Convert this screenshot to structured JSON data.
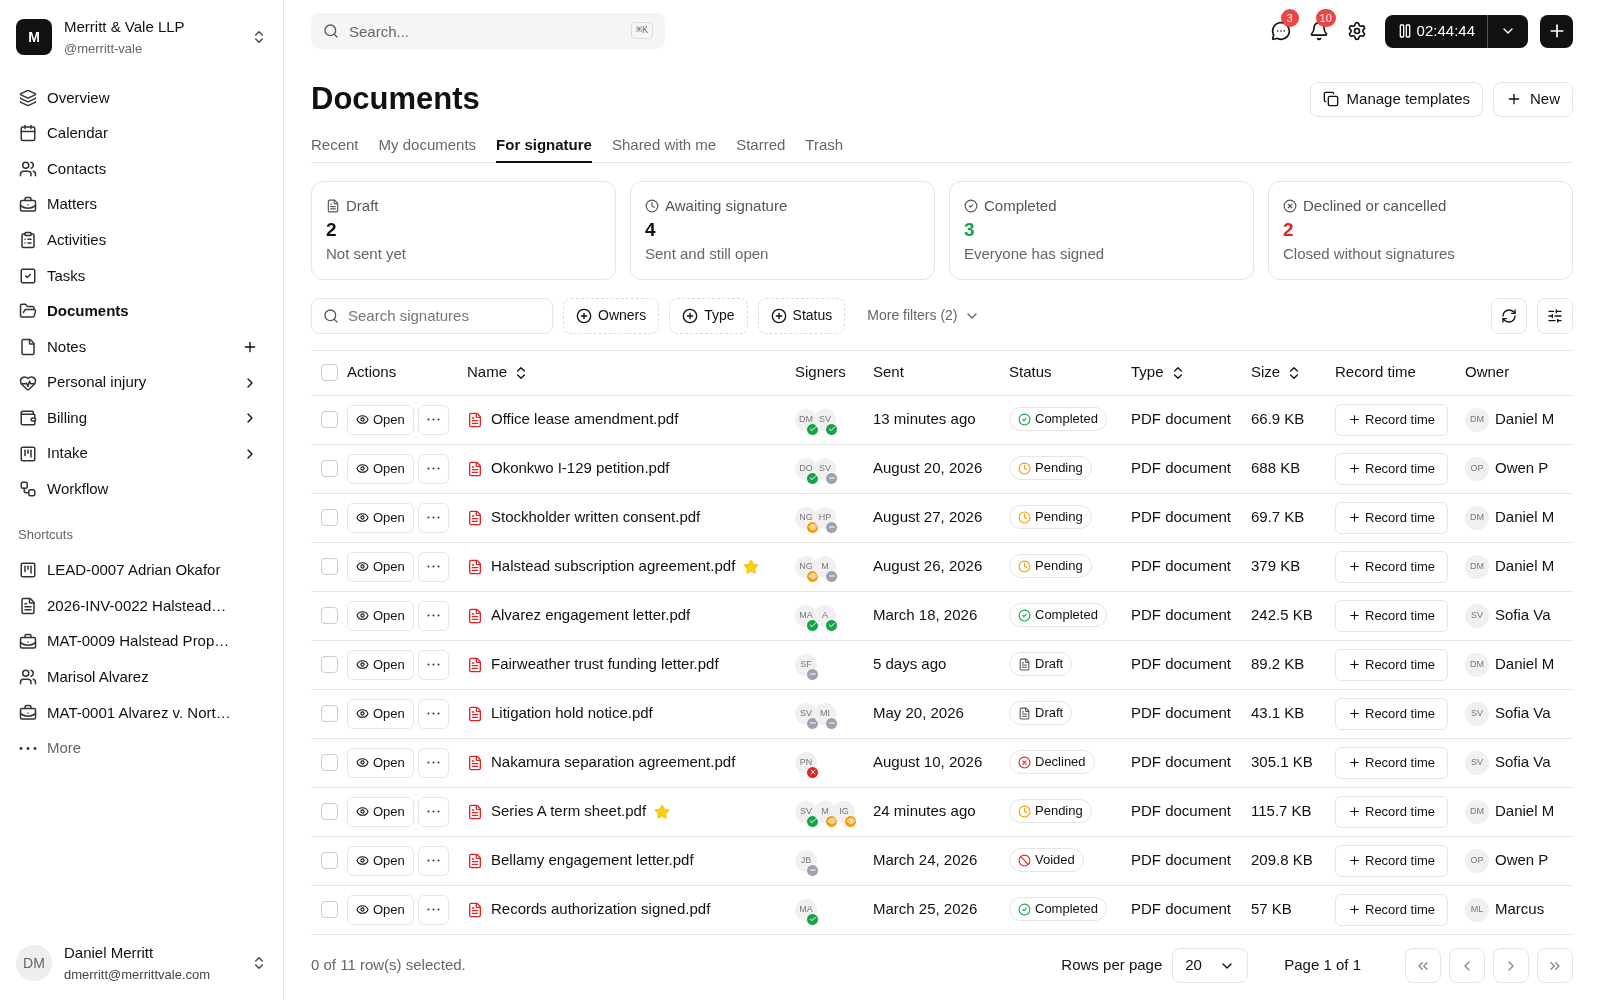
{
  "workspace": {
    "avatar": "M",
    "name": "Merritt & Vale LLP",
    "handle": "@merritt-vale"
  },
  "sidebar": {
    "items": [
      {
        "label": "Overview",
        "kind": "plain",
        "selected": false
      },
      {
        "label": "Calendar",
        "kind": "plain",
        "selected": false
      },
      {
        "label": "Contacts",
        "kind": "plain",
        "selected": false
      },
      {
        "label": "Matters",
        "kind": "plain",
        "selected": false
      },
      {
        "label": "Activities",
        "kind": "plain",
        "selected": false
      },
      {
        "label": "Tasks",
        "kind": "plain",
        "selected": false
      },
      {
        "label": "Documents",
        "kind": "plain",
        "selected": true
      },
      {
        "label": "Notes",
        "kind": "addable",
        "selected": false
      },
      {
        "label": "Personal injury",
        "kind": "expandable",
        "selected": false
      },
      {
        "label": "Billing",
        "kind": "expandable",
        "selected": false
      },
      {
        "label": "Intake",
        "kind": "expandable",
        "selected": false
      },
      {
        "label": "Workflow",
        "kind": "plain",
        "selected": false
      }
    ],
    "shortcuts_heading": "Shortcuts",
    "shortcuts": [
      {
        "label": "LEAD-0007 Adrian Okafor",
        "kind": "lead"
      },
      {
        "label": "2026-INV-0022 Halstead…",
        "kind": "invoice"
      },
      {
        "label": "MAT-0009 Halstead Prop…",
        "kind": "matter"
      },
      {
        "label": "Marisol Alvarez",
        "kind": "contact"
      },
      {
        "label": "MAT-0001 Alvarez v. Nort…",
        "kind": "matter"
      },
      {
        "label": "More",
        "kind": "more"
      }
    ]
  },
  "user": {
    "avatar": "DM",
    "name": "Daniel Merritt",
    "email": "dmerritt@merrittvale.com"
  },
  "topbar": {
    "search_placeholder": "Search...",
    "shortcut": "⌘K",
    "messages_badge": "3",
    "notifications_badge": "10",
    "timer": "02:44:44"
  },
  "page": {
    "title": "Documents",
    "buttons": [
      "Manage templates",
      "New"
    ]
  },
  "tabs": [
    {
      "label": "Recent",
      "selected": false
    },
    {
      "label": "My documents",
      "selected": false
    },
    {
      "label": "For signature",
      "selected": true
    },
    {
      "label": "Shared with me",
      "selected": false
    },
    {
      "label": "Starred",
      "selected": false
    },
    {
      "label": "Trash",
      "selected": false
    }
  ],
  "stats": [
    {
      "kind": "draft",
      "label": "Draft",
      "value": "2",
      "caption": "Not sent yet",
      "color": "#111111"
    },
    {
      "kind": "awaiting",
      "label": "Awaiting signature",
      "value": "4",
      "caption": "Sent and still open",
      "color": "#111111"
    },
    {
      "kind": "completed",
      "label": "Completed",
      "value": "3",
      "caption": "Everyone has signed",
      "color": "#16a34a"
    },
    {
      "kind": "declined",
      "label": "Declined or cancelled",
      "value": "2",
      "caption": "Closed without signatures",
      "color": "#dc2626"
    }
  ],
  "filters": {
    "search_placeholder": "Search signatures",
    "chips": [
      "Owners",
      "Type",
      "Status"
    ],
    "more": "More filters (2)"
  },
  "table": {
    "all_checked": false,
    "columns": [
      "Actions",
      "Name",
      "Signers",
      "Sent",
      "Status",
      "Type",
      "Size",
      "Record time",
      "Owner"
    ],
    "rows": [
      {
        "checked": false,
        "open": "Open",
        "name": "Office lease amendment.pdf",
        "starred": false,
        "signers": [
          {
            "initials": "DM",
            "kind": "signed"
          },
          {
            "initials": "SV",
            "kind": "signed"
          }
        ],
        "sent": "13 minutes ago",
        "status": {
          "label": "Completed",
          "kind": "completed"
        },
        "type": "PDF document",
        "size": "66.9 KB",
        "record": "Record time",
        "owner_initials": "DM",
        "owner": "Daniel M"
      },
      {
        "checked": false,
        "open": "Open",
        "name": "Okonkwo I-129 petition.pdf",
        "starred": false,
        "signers": [
          {
            "initials": "DO",
            "kind": "signed"
          },
          {
            "initials": "SV",
            "kind": "pending"
          }
        ],
        "sent": "August 20, 2026",
        "status": {
          "label": "Pending",
          "kind": "pending"
        },
        "type": "PDF document",
        "size": "688 KB",
        "record": "Record time",
        "owner_initials": "OP",
        "owner": "Owen P"
      },
      {
        "checked": false,
        "open": "Open",
        "name": "Stockholder written consent.pdf",
        "starred": false,
        "signers": [
          {
            "initials": "NG",
            "kind": "viewed"
          },
          {
            "initials": "HP",
            "kind": "pending"
          }
        ],
        "sent": "August 27, 2026",
        "status": {
          "label": "Pending",
          "kind": "pending"
        },
        "type": "PDF document",
        "size": "69.7 KB",
        "record": "Record time",
        "owner_initials": "DM",
        "owner": "Daniel M"
      },
      {
        "checked": false,
        "open": "Open",
        "name": "Halstead subscription agreement.pdf",
        "starred": true,
        "signers": [
          {
            "initials": "NG",
            "kind": "viewed"
          },
          {
            "initials": "M",
            "kind": "pending"
          }
        ],
        "sent": "August 26, 2026",
        "status": {
          "label": "Pending",
          "kind": "pending"
        },
        "type": "PDF document",
        "size": "379 KB",
        "record": "Record time",
        "owner_initials": "DM",
        "owner": "Daniel M"
      },
      {
        "checked": false,
        "open": "Open",
        "name": "Alvarez engagement letter.pdf",
        "starred": false,
        "signers": [
          {
            "initials": "MA",
            "kind": "signed"
          },
          {
            "initials": "A",
            "kind": "signed"
          }
        ],
        "sent": "March 18, 2026",
        "status": {
          "label": "Completed",
          "kind": "completed"
        },
        "type": "PDF document",
        "size": "242.5 KB",
        "record": "Record time",
        "owner_initials": "SV",
        "owner": "Sofia Va"
      },
      {
        "checked": false,
        "open": "Open",
        "name": "Fairweather trust funding letter.pdf",
        "starred": false,
        "signers": [
          {
            "initials": "SF",
            "kind": "pending"
          }
        ],
        "sent": "5 days ago",
        "status": {
          "label": "Draft",
          "kind": "draft"
        },
        "type": "PDF document",
        "size": "89.2 KB",
        "record": "Record time",
        "owner_initials": "DM",
        "owner": "Daniel M"
      },
      {
        "checked": false,
        "open": "Open",
        "name": "Litigation hold notice.pdf",
        "starred": false,
        "signers": [
          {
            "initials": "SV",
            "kind": "pending"
          },
          {
            "initials": "MI",
            "kind": "pending"
          }
        ],
        "sent": "May 20, 2026",
        "status": {
          "label": "Draft",
          "kind": "draft"
        },
        "type": "PDF document",
        "size": "43.1 KB",
        "record": "Record time",
        "owner_initials": "SV",
        "owner": "Sofia Va"
      },
      {
        "checked": false,
        "open": "Open",
        "name": "Nakamura separation agreement.pdf",
        "starred": false,
        "signers": [
          {
            "initials": "PN",
            "kind": "declined"
          }
        ],
        "sent": "August 10, 2026",
        "status": {
          "label": "Declined",
          "kind": "declined"
        },
        "type": "PDF document",
        "size": "305.1 KB",
        "record": "Record time",
        "owner_initials": "SV",
        "owner": "Sofia Va"
      },
      {
        "checked": false,
        "open": "Open",
        "name": "Series A term sheet.pdf",
        "starred": true,
        "signers": [
          {
            "initials": "SV",
            "kind": "signed"
          },
          {
            "initials": "M",
            "kind": "viewed"
          },
          {
            "initials": "IG",
            "kind": "viewed"
          }
        ],
        "sent": "24 minutes ago",
        "status": {
          "label": "Pending",
          "kind": "pending"
        },
        "type": "PDF document",
        "size": "115.7 KB",
        "record": "Record time",
        "owner_initials": "DM",
        "owner": "Daniel M"
      },
      {
        "checked": false,
        "open": "Open",
        "name": "Bellamy engagement letter.pdf",
        "starred": false,
        "signers": [
          {
            "initials": "JB",
            "kind": "pending"
          }
        ],
        "sent": "March 24, 2026",
        "status": {
          "label": "Voided",
          "kind": "voided"
        },
        "type": "PDF document",
        "size": "209.8 KB",
        "record": "Record time",
        "owner_initials": "OP",
        "owner": "Owen P"
      },
      {
        "checked": false,
        "open": "Open",
        "name": "Records authorization signed.pdf",
        "starred": false,
        "signers": [
          {
            "initials": "MA",
            "kind": "signed"
          }
        ],
        "sent": "March 25, 2026",
        "status": {
          "label": "Completed",
          "kind": "completed"
        },
        "type": "PDF document",
        "size": "57 KB",
        "record": "Record time",
        "owner_initials": "ML",
        "owner": "Marcus"
      }
    ]
  },
  "footer": {
    "selection": "0 of 11 row(s) selected.",
    "rows_per_page_label": "Rows per page",
    "rows_per_page": "20",
    "page": "Page 1 of 1"
  }
}
